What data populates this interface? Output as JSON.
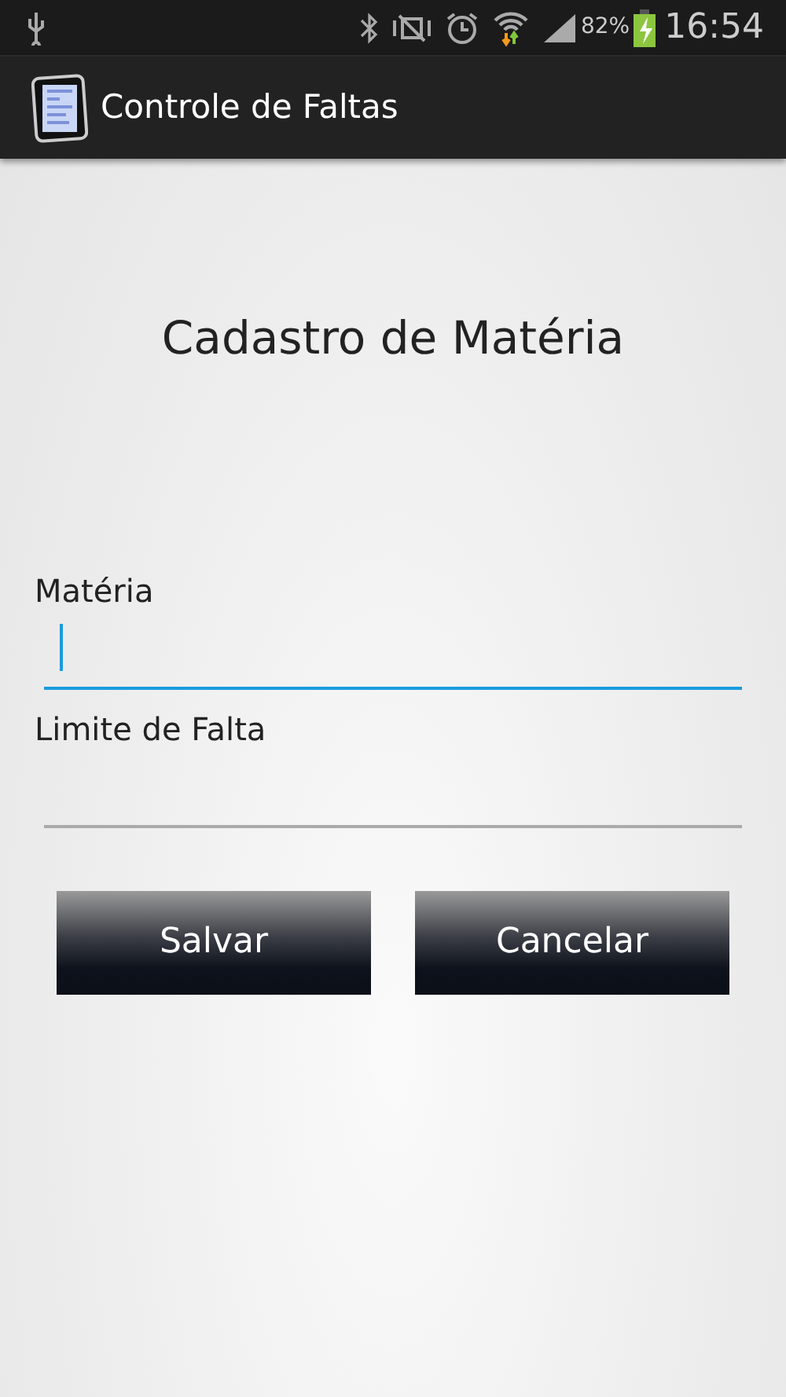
{
  "status_bar": {
    "battery": "82%",
    "time": "16:54"
  },
  "app_bar": {
    "title": "Controle de Faltas"
  },
  "heading": "Cadastro de Matéria",
  "fields": [
    {
      "label": "Matéria",
      "focused": true
    },
    {
      "label": "Limite de Falta",
      "focused": false
    }
  ],
  "buttons": [
    "Salvar",
    "Cancelar"
  ]
}
